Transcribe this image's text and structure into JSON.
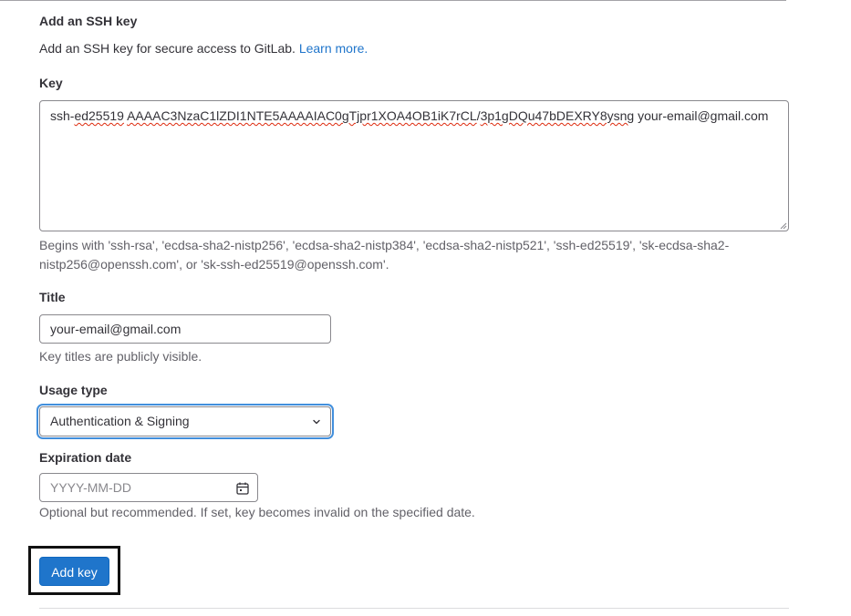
{
  "section": {
    "title": "Add an SSH key",
    "description": "Add an SSH key for secure access to GitLab.",
    "learn_more": "Learn more."
  },
  "key": {
    "label": "Key",
    "value_part1": "ssh-",
    "value_part2": "ed25519",
    "value_part3": " ",
    "value_part4": "AAAAC3NzaC1lZDI1NTE5AAAAIAC0gTjpr1XOA4OB1iK7rCL",
    "value_part5": "/",
    "value_part6": "3p1gDQu47bDEXRY8ysng",
    "value_part7": " your-email@gmail.com",
    "help": "Begins with 'ssh-rsa', 'ecdsa-sha2-nistp256', 'ecdsa-sha2-nistp384', 'ecdsa-sha2-nistp521', 'ssh-ed25519', 'sk-ecdsa-sha2-nistp256@openssh.com', or 'sk-ssh-ed25519@openssh.com'."
  },
  "title_field": {
    "label": "Title",
    "value": "your-email@gmail.com",
    "help": "Key titles are publicly visible."
  },
  "usage": {
    "label": "Usage type",
    "selected": "Authentication & Signing"
  },
  "expiration": {
    "label": "Expiration date",
    "placeholder": "YYYY-MM-DD",
    "help": "Optional but recommended. If set, key becomes invalid on the specified date."
  },
  "actions": {
    "add_key": "Add key"
  },
  "colors": {
    "primary": "#1f75cb",
    "link": "#1f75cb",
    "focus_ring": "#428fdc"
  }
}
